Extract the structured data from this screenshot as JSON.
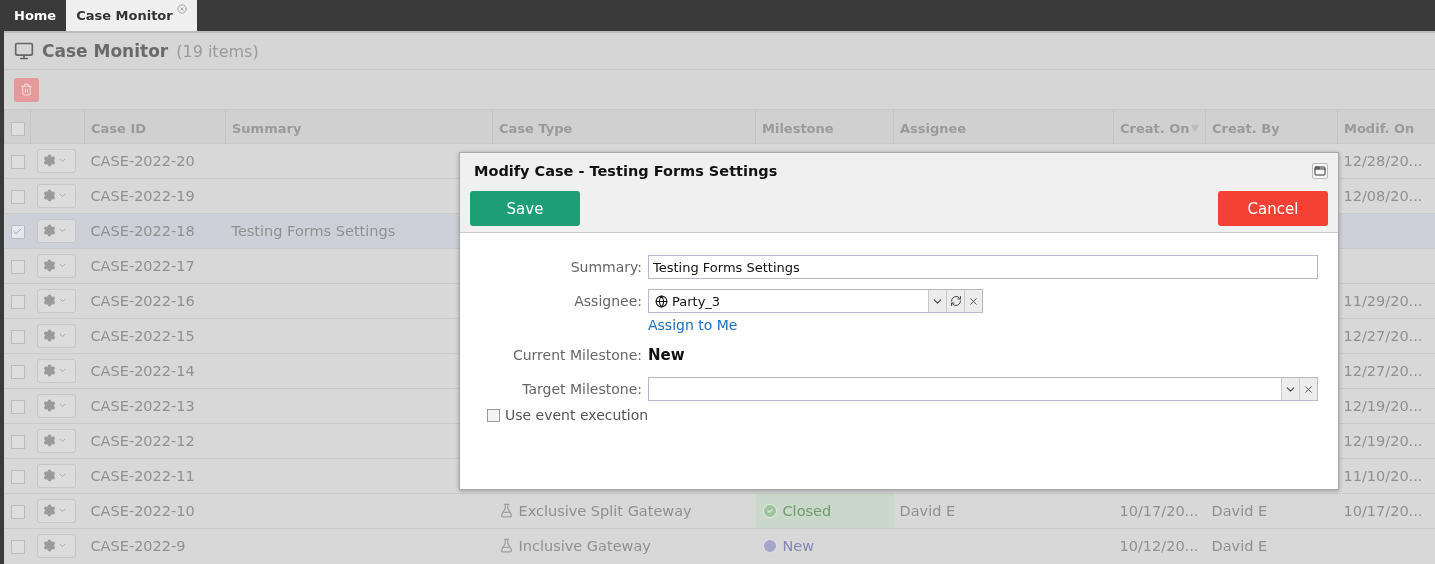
{
  "tabs": [
    {
      "label": "Home",
      "selected": false,
      "closable": false
    },
    {
      "label": "Case Monitor",
      "selected": true,
      "closable": true
    }
  ],
  "header": {
    "title": "Case Monitor",
    "count": "(19 items)"
  },
  "table": {
    "all_checked": false,
    "columns": [
      {
        "label": "Case ID",
        "sorted": false
      },
      {
        "label": "Summary",
        "sorted": false
      },
      {
        "label": "Case Type",
        "sorted": false
      },
      {
        "label": "Milestone",
        "sorted": false
      },
      {
        "label": "Assignee",
        "sorted": false
      },
      {
        "label": "Creat. On",
        "sorted": true
      },
      {
        "label": "Creat. By",
        "sorted": false
      },
      {
        "label": "Modif. On",
        "sorted": false
      }
    ],
    "rows": [
      {
        "case_id": "CASE-2022-20",
        "modified_on": "12/28/20...",
        "selected": false
      },
      {
        "case_id": "CASE-2022-19",
        "modified_on": "12/08/20...",
        "selected": false
      },
      {
        "case_id": "CASE-2022-18",
        "summary": "Testing Forms Settings",
        "selected": true
      },
      {
        "case_id": "CASE-2022-17",
        "selected": false
      },
      {
        "case_id": "CASE-2022-16",
        "modified_on": "11/29/20...",
        "selected": false
      },
      {
        "case_id": "CASE-2022-15",
        "modified_on": "12/27/20...",
        "selected": false
      },
      {
        "case_id": "CASE-2022-14",
        "modified_on": "12/27/20...",
        "selected": false
      },
      {
        "case_id": "CASE-2022-13",
        "modified_on": "12/19/20...",
        "selected": false
      },
      {
        "case_id": "CASE-2022-12",
        "modified_on": "12/19/20...",
        "selected": false
      },
      {
        "case_id": "CASE-2022-11",
        "modified_on": "11/10/20...",
        "selected": false
      },
      {
        "case_id": "CASE-2022-10",
        "case_type": "Exclusive Split Gateway",
        "milestone": {
          "label": "Closed",
          "kind": "closed"
        },
        "assignee": "David E",
        "created_on": "10/17/20...",
        "created_by": "David E",
        "modified_on": "10/17/20...",
        "selected": false
      },
      {
        "case_id": "CASE-2022-9",
        "case_type": "Inclusive Gateway",
        "milestone": {
          "label": "New",
          "kind": "new"
        },
        "created_on": "10/12/20...",
        "created_by": "David E",
        "selected": false
      }
    ]
  },
  "dialog": {
    "title": "Modify Case - Testing Forms Settings",
    "buttons": [
      {
        "label": "Save",
        "kind": "primary"
      },
      {
        "label": "Cancel",
        "kind": "danger"
      }
    ],
    "fields": [
      {
        "kind": "text",
        "label": "Summary:",
        "value": "Testing Forms Settings"
      },
      {
        "kind": "combo",
        "label": "Assignee:",
        "value": "Party_3",
        "link": "Assign to Me"
      },
      {
        "kind": "static",
        "label": "Current Milestone:",
        "value": "New"
      },
      {
        "kind": "select",
        "label": "Target Milestone:"
      }
    ],
    "option": {
      "label": "Use event execution",
      "checked": false
    }
  }
}
